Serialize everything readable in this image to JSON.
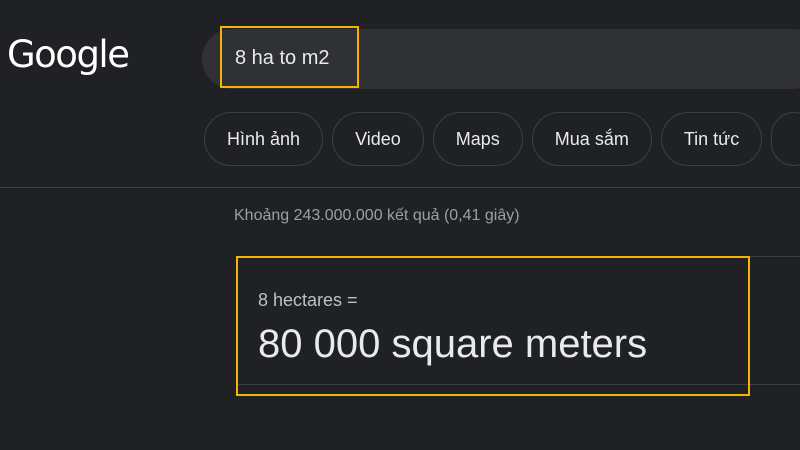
{
  "header": {
    "logo_text": "Google",
    "search": {
      "query": "8 ha to m2"
    }
  },
  "tabs": [
    {
      "label": "Hình ảnh"
    },
    {
      "label": "Video"
    },
    {
      "label": "Maps"
    },
    {
      "label": "Mua sắm"
    },
    {
      "label": "Tin tức"
    }
  ],
  "results": {
    "stats": "Khoảng 243.000.000 kết quả (0,41 giây)",
    "answer": {
      "from": "8 hectares =",
      "result": "80 000 square meters"
    }
  },
  "colors": {
    "background": "#202124",
    "search_bar": "#303134",
    "highlight": "#f4b400",
    "text": "#e8eaed",
    "muted_text": "#9aa0a6"
  }
}
